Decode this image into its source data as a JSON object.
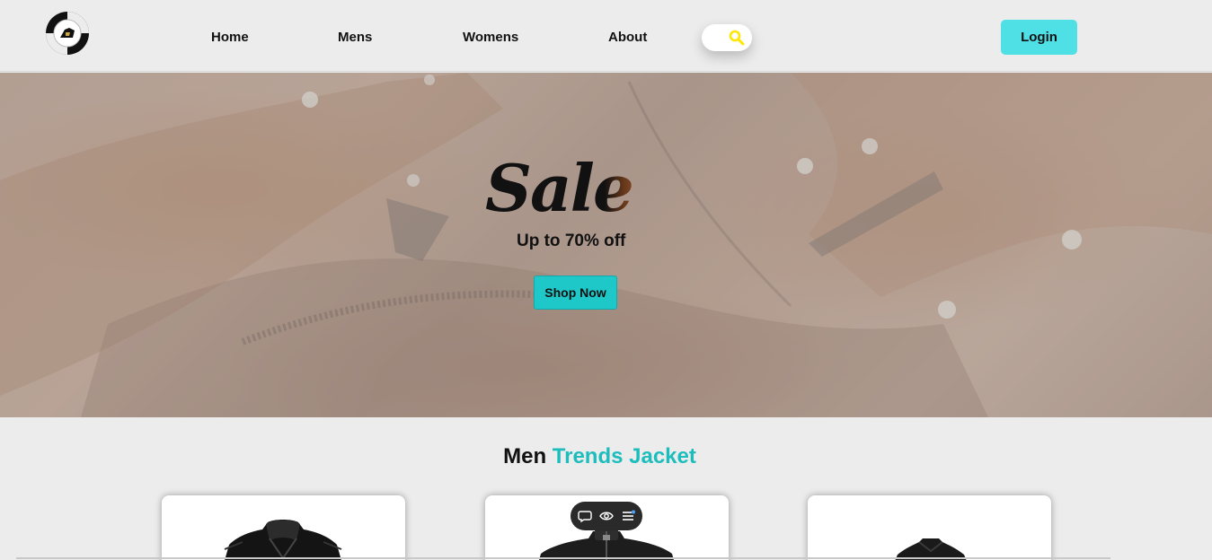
{
  "nav": {
    "items": [
      "Home",
      "Mens",
      "Womens",
      "About"
    ],
    "search_icon": "search-icon",
    "login_label": "Login"
  },
  "hero": {
    "title": "Sale",
    "subtitle": "Up to 70% off",
    "cta_label": "Shop Now"
  },
  "trends": {
    "title_main": "Men",
    "title_accent": "Trends Jacket"
  },
  "toolbar": {
    "icons": [
      "comment-icon",
      "eye-icon",
      "menu-icon"
    ]
  },
  "colors": {
    "accent": "#1ebdbd",
    "login_bg": "#4fe0e6",
    "search_icon": "#ffe600"
  }
}
